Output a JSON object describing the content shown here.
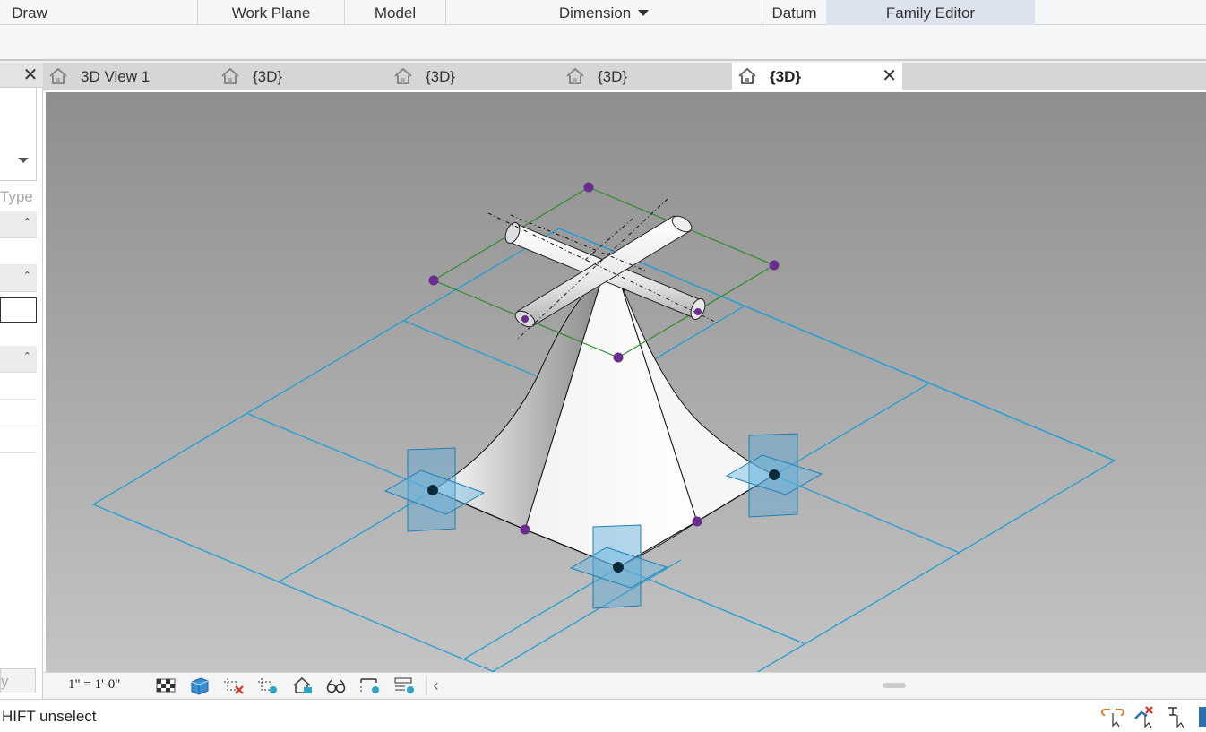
{
  "ribbon": {
    "tabs": [
      {
        "label": "Draw"
      },
      {
        "label": "Work Plane"
      },
      {
        "label": "Model"
      },
      {
        "label": "Dimension"
      },
      {
        "label": "Datum"
      },
      {
        "label": "Family Editor"
      }
    ],
    "active_tab": "Family Editor"
  },
  "properties_panel": {
    "type_label": "Type",
    "apply_label": "y"
  },
  "view_tabs": [
    {
      "label": "3D View 1",
      "icon": "house-icon"
    },
    {
      "label": "{3D}",
      "icon": "house-icon"
    },
    {
      "label": "{3D}",
      "icon": "house-icon"
    },
    {
      "label": "{3D}",
      "icon": "house-icon"
    },
    {
      "label": "{3D}",
      "icon": "house-icon",
      "active": true
    }
  ],
  "view_bar": {
    "scale": "1\" = 1'-0\"",
    "icons": [
      "detail-level-icon",
      "visual-style-icon",
      "hide-crop-icon",
      "crop-region-icon",
      "shadows-icon",
      "temporary-hide-icon",
      "reveal-hidden-icon",
      "workplane-icon"
    ]
  },
  "status_bar": {
    "text": "HIFT unselect",
    "icons": [
      "select-links-icon",
      "select-pinned-icon",
      "drag-elements-icon"
    ]
  },
  "colors": {
    "viewport_top": "#8e8e8e",
    "viewport_bottom": "#c2c2c2",
    "reference_plane": "#1e9fd4",
    "sketch_line": "#2e8b2e",
    "grip_dot": "#6b2c8f"
  }
}
